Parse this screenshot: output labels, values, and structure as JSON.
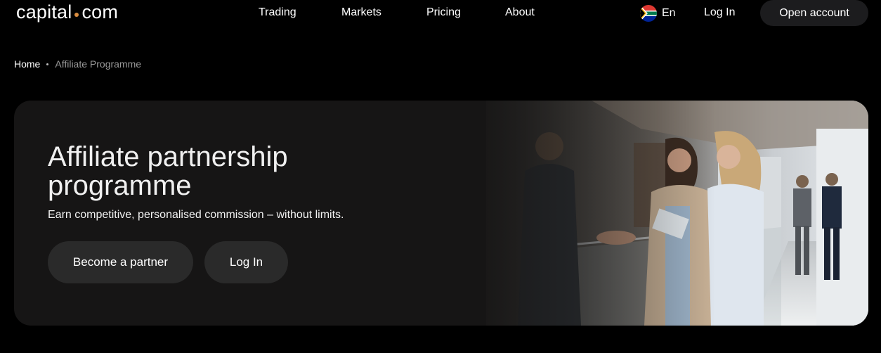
{
  "header": {
    "logo_left": "capital",
    "logo_right": "com",
    "nav": [
      "Trading",
      "Markets",
      "Pricing",
      "About"
    ],
    "language": "En",
    "flag_icon": "south-africa-flag-icon",
    "login": "Log In",
    "open_account": "Open account"
  },
  "breadcrumb": {
    "home": "Home",
    "current": "Affiliate Programme"
  },
  "hero": {
    "title": "Affiliate partnership programme",
    "subtitle": "Earn competitive, personalised commission – without limits.",
    "primary_button": "Become a partner",
    "secondary_button": "Log In",
    "image": "business-people-handshake-photo"
  },
  "colors": {
    "background": "#000000",
    "card": "#161515",
    "button": "#2a2a2a",
    "logo_dot": "#d98c3f"
  }
}
